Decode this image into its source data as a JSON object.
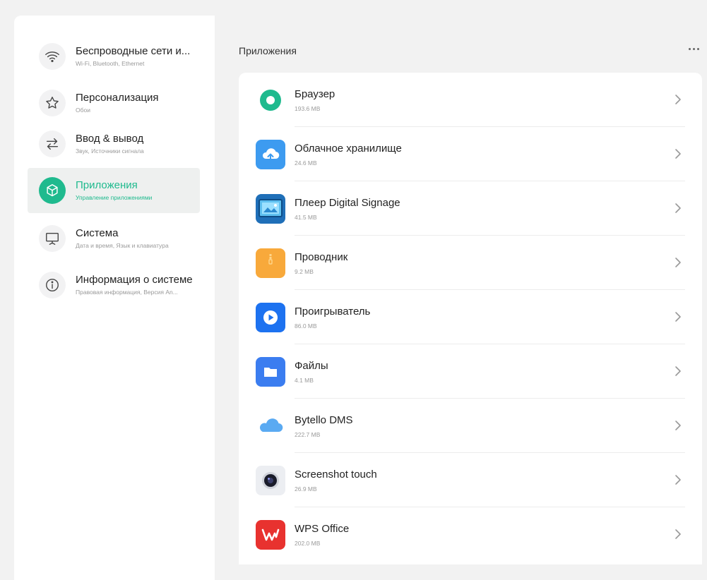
{
  "sidebar": {
    "items": [
      {
        "title": "Беспроводные сети и...",
        "subtitle": "Wi-Fi, Bluetooth, Ethernet",
        "icon": "wifi-icon"
      },
      {
        "title": "Персонализация",
        "subtitle": "Обои",
        "icon": "star-icon"
      },
      {
        "title": "Ввод & вывод",
        "subtitle": "Звук, Источники сигнала",
        "icon": "swap-arrows-icon"
      },
      {
        "title": "Приложения",
        "subtitle": "Управление приложениями",
        "icon": "cube-icon",
        "active": true
      },
      {
        "title": "Система",
        "subtitle": "Дата и время, Язык и клавиатура",
        "icon": "monitor-icon"
      },
      {
        "title": "Информация о системе",
        "subtitle": "Правовая информация, Версия An...",
        "icon": "info-icon"
      }
    ]
  },
  "main": {
    "title": "Приложения",
    "more_icon": "more-icon"
  },
  "apps": [
    {
      "name": "Браузер",
      "size": "193.6 MB",
      "icon": "browser-icon"
    },
    {
      "name": "Облачное хранилище",
      "size": "24.6 MB",
      "icon": "cloud-storage-icon"
    },
    {
      "name": "Плеер Digital Signage",
      "size": "41.5 MB",
      "icon": "signage-player-icon"
    },
    {
      "name": "Проводник",
      "size": "9.2 MB",
      "icon": "explorer-icon"
    },
    {
      "name": "Проигрыватель",
      "size": "86.0 MB",
      "icon": "video-player-icon"
    },
    {
      "name": "Файлы",
      "size": "4.1 MB",
      "icon": "folder-icon"
    },
    {
      "name": "Bytello DMS",
      "size": "222.7 MB",
      "icon": "cloud-icon"
    },
    {
      "name": "Screenshot touch",
      "size": "26.9 MB",
      "icon": "camera-icon"
    },
    {
      "name": "WPS Office",
      "size": "202.0 MB",
      "icon": "wps-icon"
    }
  ],
  "colors": {
    "accent": "#1fba8e",
    "background": "#f2f2f2",
    "panel": "#ffffff"
  }
}
